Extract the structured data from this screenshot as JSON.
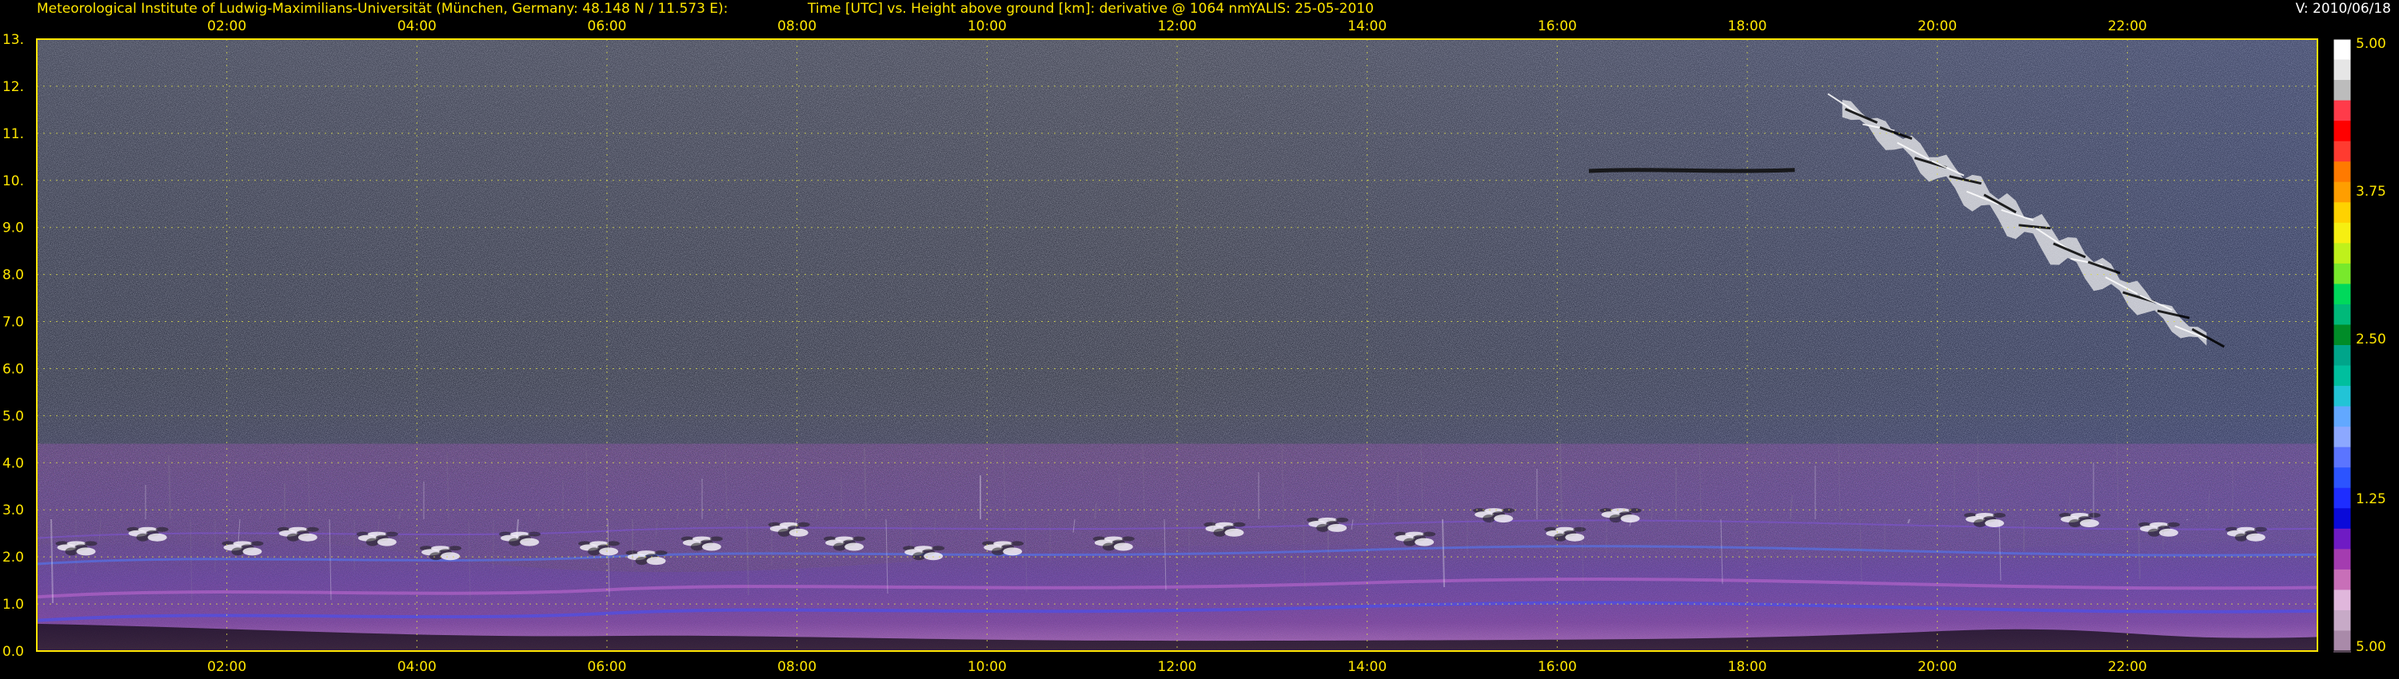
{
  "header": {
    "left": "Meteorological Institute of Ludwig-Maximilians-Universität (München, Germany: 48.148 N / 11.573 E):",
    "middle": "Time [UTC] vs. Height above ground [km]: derivative @ 1064 nm",
    "site": "YALIS: 25-05-2010",
    "version": "V: 2010/06/18"
  },
  "colors": {
    "background": "#000000",
    "axis_text": "#ffe600",
    "grid": "#d8d84c",
    "noise_dark": "#6d6d6d",
    "noise_light": "#ffffff",
    "aerosol_purple": "#7b3ca0",
    "aerosol_blue": "#3b55d6",
    "aerosol_pink": "#d38fd8"
  },
  "chart_data": {
    "type": "heatmap",
    "title": "Time [UTC] vs. Height above ground [km]: derivative @ 1064 nm",
    "xlabel": "",
    "ylabel": "",
    "x_ticks": [
      "02:00",
      "04:00",
      "06:00",
      "08:00",
      "10:00",
      "12:00",
      "14:00",
      "16:00",
      "18:00",
      "20:00",
      "22:00"
    ],
    "y_ticks": [
      "0.0",
      "1.0",
      "2.0",
      "3.0",
      "4.0",
      "5.0",
      "6.0",
      "7.0",
      "8.0",
      "9.0",
      "10.",
      "11.",
      "12.",
      "13."
    ],
    "xlim": [
      "00:00",
      "24:00"
    ],
    "ylim": [
      0,
      13
    ],
    "grid": true,
    "colorbar": {
      "labels": [
        "5.00",
        "3.75",
        "2.50",
        "1.25",
        "5.00"
      ],
      "colors": [
        "#ffffff",
        "#e6e6e6",
        "#bcbcbc",
        "#ff3b4a",
        "#ff0000",
        "#ff3b30",
        "#ff7a00",
        "#ff9e00",
        "#ffd200",
        "#f6ef11",
        "#bff11b",
        "#78e92c",
        "#00d95b",
        "#00b979",
        "#008c28",
        "#00a58a",
        "#00bf9e",
        "#22c4d6",
        "#62a8ff",
        "#8ca8ff",
        "#5b75ff",
        "#2c54ff",
        "#1e2dff",
        "#0a0ad9",
        "#6f1bc4",
        "#a43cb0",
        "#c86fb8",
        "#e0b7dc",
        "#c7aac7",
        "#a98aa9"
      ]
    },
    "features": [
      {
        "name": "boundary-layer",
        "start": "00:00",
        "end": "24:00",
        "top_km": 2.8,
        "base_km": 0.0
      },
      {
        "name": "cirrus-band",
        "start": "19:00",
        "end": "22:50",
        "height_km": [
          11.6,
          6.6
        ]
      },
      {
        "name": "thin-layer",
        "start": "16:20",
        "end": "18:30",
        "height_km": 10.2
      }
    ]
  }
}
